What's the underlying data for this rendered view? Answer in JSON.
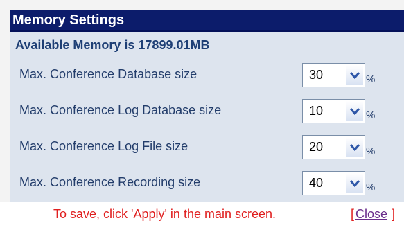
{
  "window": {
    "title": "Memory Settings"
  },
  "available": {
    "text": "Available Memory is 17899.01MB"
  },
  "rows": [
    {
      "label": "Max. Conference Database size",
      "value": "30",
      "unit": "%"
    },
    {
      "label": "Max. Conference Log Database size",
      "value": "10",
      "unit": "%"
    },
    {
      "label": "Max. Conference Log File size",
      "value": "20",
      "unit": "%"
    },
    {
      "label": "Max. Conference Recording size",
      "value": "40",
      "unit": "%"
    }
  ],
  "footer": {
    "note": "To save, click 'Apply' in the main screen.",
    "bracket_open": "[",
    "close_label": "Close",
    "bracket_close": "]"
  },
  "colors": {
    "title_bg": "#0c1c6b",
    "panel_bg": "#dde4ee",
    "note_text": "#e02020",
    "link": "#6b2e8c"
  },
  "icons": {
    "dropdown": "chevron-down-icon"
  }
}
